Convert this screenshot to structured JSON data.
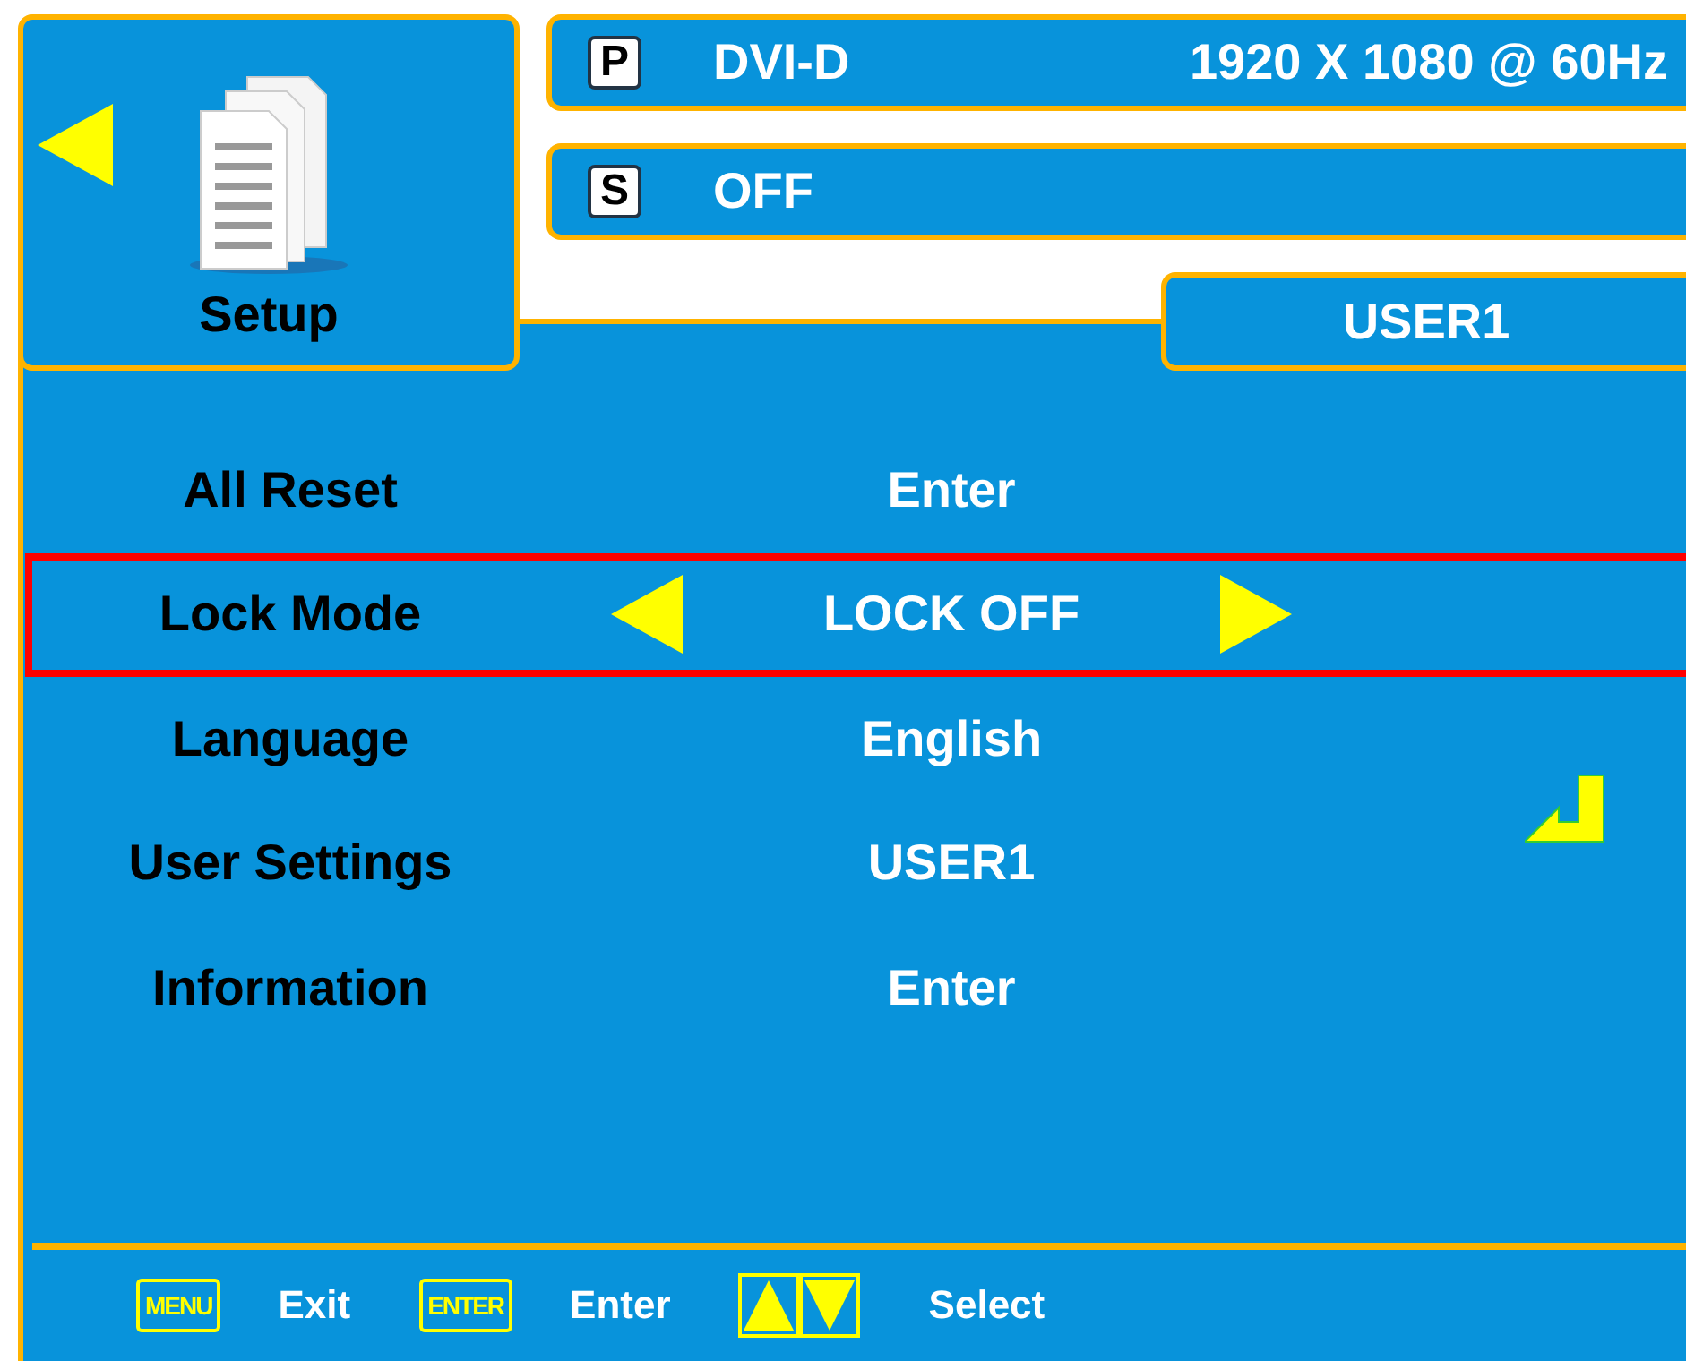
{
  "menu": {
    "title": "Setup"
  },
  "status": [
    {
      "badge": "P",
      "label": "DVI-D",
      "detail": "1920 X 1080 @ 60Hz"
    },
    {
      "badge": "S",
      "label": "OFF"
    }
  ],
  "profile_tab": "USER1",
  "rows": [
    {
      "label": "All Reset",
      "value": "Enter",
      "selected": false
    },
    {
      "label": "Lock Mode",
      "value": "LOCK OFF",
      "selected": true
    },
    {
      "label": "Language",
      "value": "English",
      "selected": false
    },
    {
      "label": "User Settings",
      "value": "USER1",
      "selected": false
    },
    {
      "label": "Information",
      "value": "Enter",
      "selected": false
    }
  ],
  "footer": [
    {
      "kind": "key",
      "key": "MENU",
      "action": "Exit"
    },
    {
      "kind": "key",
      "key": "ENTER",
      "action": "Enter"
    },
    {
      "kind": "arrows",
      "action": "Select"
    }
  ]
}
